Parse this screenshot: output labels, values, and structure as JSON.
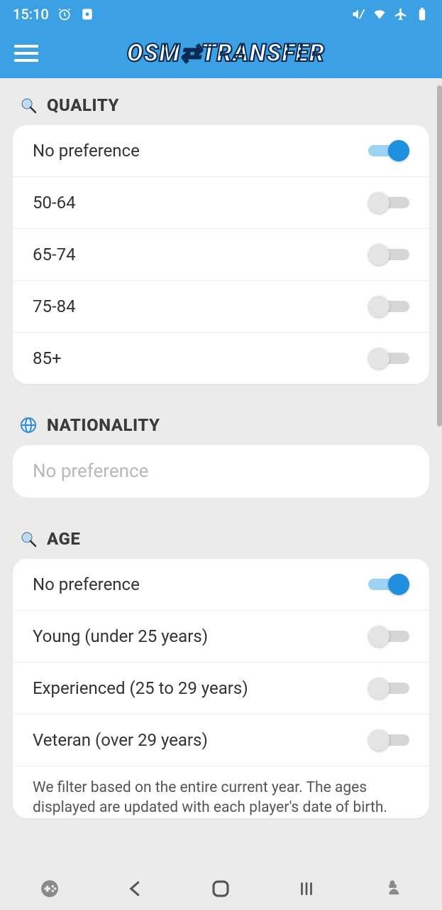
{
  "status": {
    "time": "15:10"
  },
  "app": {
    "title": "OSM⇄TRANSFER"
  },
  "quality": {
    "header": "QUALITY",
    "options": [
      {
        "label": "No preference",
        "on": true
      },
      {
        "label": "50-64",
        "on": false
      },
      {
        "label": "65-74",
        "on": false
      },
      {
        "label": "75-84",
        "on": false
      },
      {
        "label": "85+",
        "on": false
      }
    ]
  },
  "nationality": {
    "header": "NATIONALITY",
    "placeholder": "No preference"
  },
  "age": {
    "header": "AGE",
    "options": [
      {
        "label": "No preference",
        "on": true
      },
      {
        "label": "Young (under 25 years)",
        "on": false
      },
      {
        "label": "Experienced (25 to 29 years)",
        "on": false
      },
      {
        "label": "Veteran (over 29 years)",
        "on": false
      }
    ],
    "footnote": "We filter based on the entire current year. The ages displayed are updated with each player's date of birth."
  }
}
